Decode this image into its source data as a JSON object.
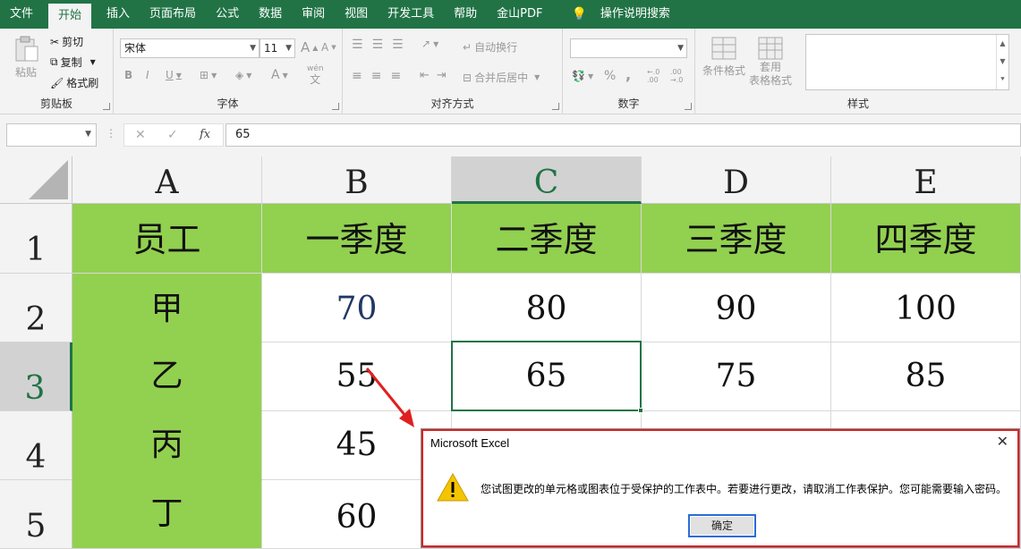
{
  "menu": {
    "items": [
      "文件",
      "开始",
      "插入",
      "页面布局",
      "公式",
      "数据",
      "审阅",
      "视图",
      "开发工具",
      "帮助",
      "金山PDF"
    ],
    "active_index": 1,
    "search_label": "操作说明搜索"
  },
  "ribbon": {
    "clipboard": {
      "paste": "粘贴",
      "cut": "剪切",
      "copy": "复制",
      "format_painter": "格式刷",
      "label": "剪贴板"
    },
    "font": {
      "name": "宋体",
      "size": "11",
      "bold": "B",
      "italic": "I",
      "underline": "U",
      "grow": "A",
      "shrink": "A",
      "font_color": "A",
      "wen": "wén",
      "wen_char": "文",
      "label": "字体"
    },
    "alignment": {
      "wrap": "自动换行",
      "merge": "合并后居中",
      "label": "对齐方式"
    },
    "number": {
      "format": "",
      "percent": "%",
      "comma": ",",
      "dec_inc": "←.0\n.00",
      "dec_dec": ".00\n→.0",
      "label": "数字"
    },
    "styles": {
      "conditional": "条件格式",
      "table_format_1": "套用",
      "table_format_2": "表格格式",
      "label": "样式"
    }
  },
  "formula_bar": {
    "name_box": "",
    "cancel": "✕",
    "enter": "✓",
    "fx": "fx",
    "value": "65"
  },
  "sheet": {
    "columns": [
      "A",
      "B",
      "C",
      "D",
      "E"
    ],
    "selected_column": "C",
    "rows": [
      "1",
      "2",
      "3",
      "4",
      "5"
    ],
    "selected_row": "3",
    "data": [
      [
        "员工",
        "一季度",
        "二季度",
        "三季度",
        "四季度"
      ],
      [
        "甲",
        "70",
        "80",
        "90",
        "100"
      ],
      [
        "乙",
        "55",
        "65",
        "75",
        "85"
      ],
      [
        "丙",
        "45",
        "",
        "",
        ""
      ],
      [
        "丁",
        "60",
        "",
        "",
        ""
      ]
    ],
    "colors": {
      "header_green": "#92d050",
      "accent": "#217346"
    }
  },
  "dialog": {
    "title": "Microsoft Excel",
    "message": "您试图更改的单元格或图表位于受保护的工作表中。若要进行更改，请取消工作表保护。您可能需要输入密码。",
    "ok": "确定",
    "close": "✕",
    "annotation_color": "#e02020"
  }
}
